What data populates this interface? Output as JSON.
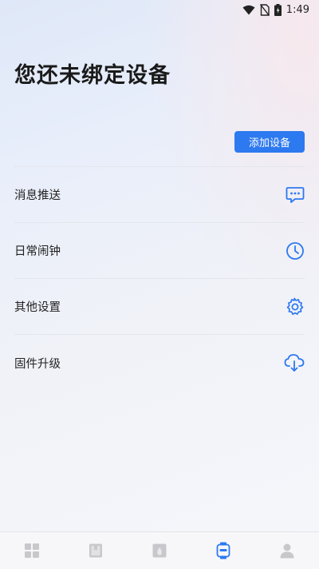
{
  "status_bar": {
    "time": "1:49",
    "icons": [
      "wifi-icon",
      "no-sim-icon",
      "battery-icon"
    ]
  },
  "page": {
    "title": "您还未绑定设备",
    "add_device_label": "添加设备"
  },
  "menu": {
    "items": [
      {
        "label": "消息推送",
        "icon": "message-icon"
      },
      {
        "label": "日常闹钟",
        "icon": "clock-icon"
      },
      {
        "label": "其他设置",
        "icon": "gear-icon"
      },
      {
        "label": "固件升级",
        "icon": "cloud-download-icon"
      }
    ]
  },
  "tab_bar": {
    "tabs": [
      {
        "icon": "grid-icon",
        "active": false
      },
      {
        "icon": "book-icon",
        "active": false
      },
      {
        "icon": "home-icon",
        "active": false
      },
      {
        "icon": "watch-icon",
        "active": true
      },
      {
        "icon": "person-icon",
        "active": false
      }
    ]
  },
  "colors": {
    "accent": "#2d79f0",
    "inactive_tab": "#c8c8cc",
    "text": "#222222"
  }
}
